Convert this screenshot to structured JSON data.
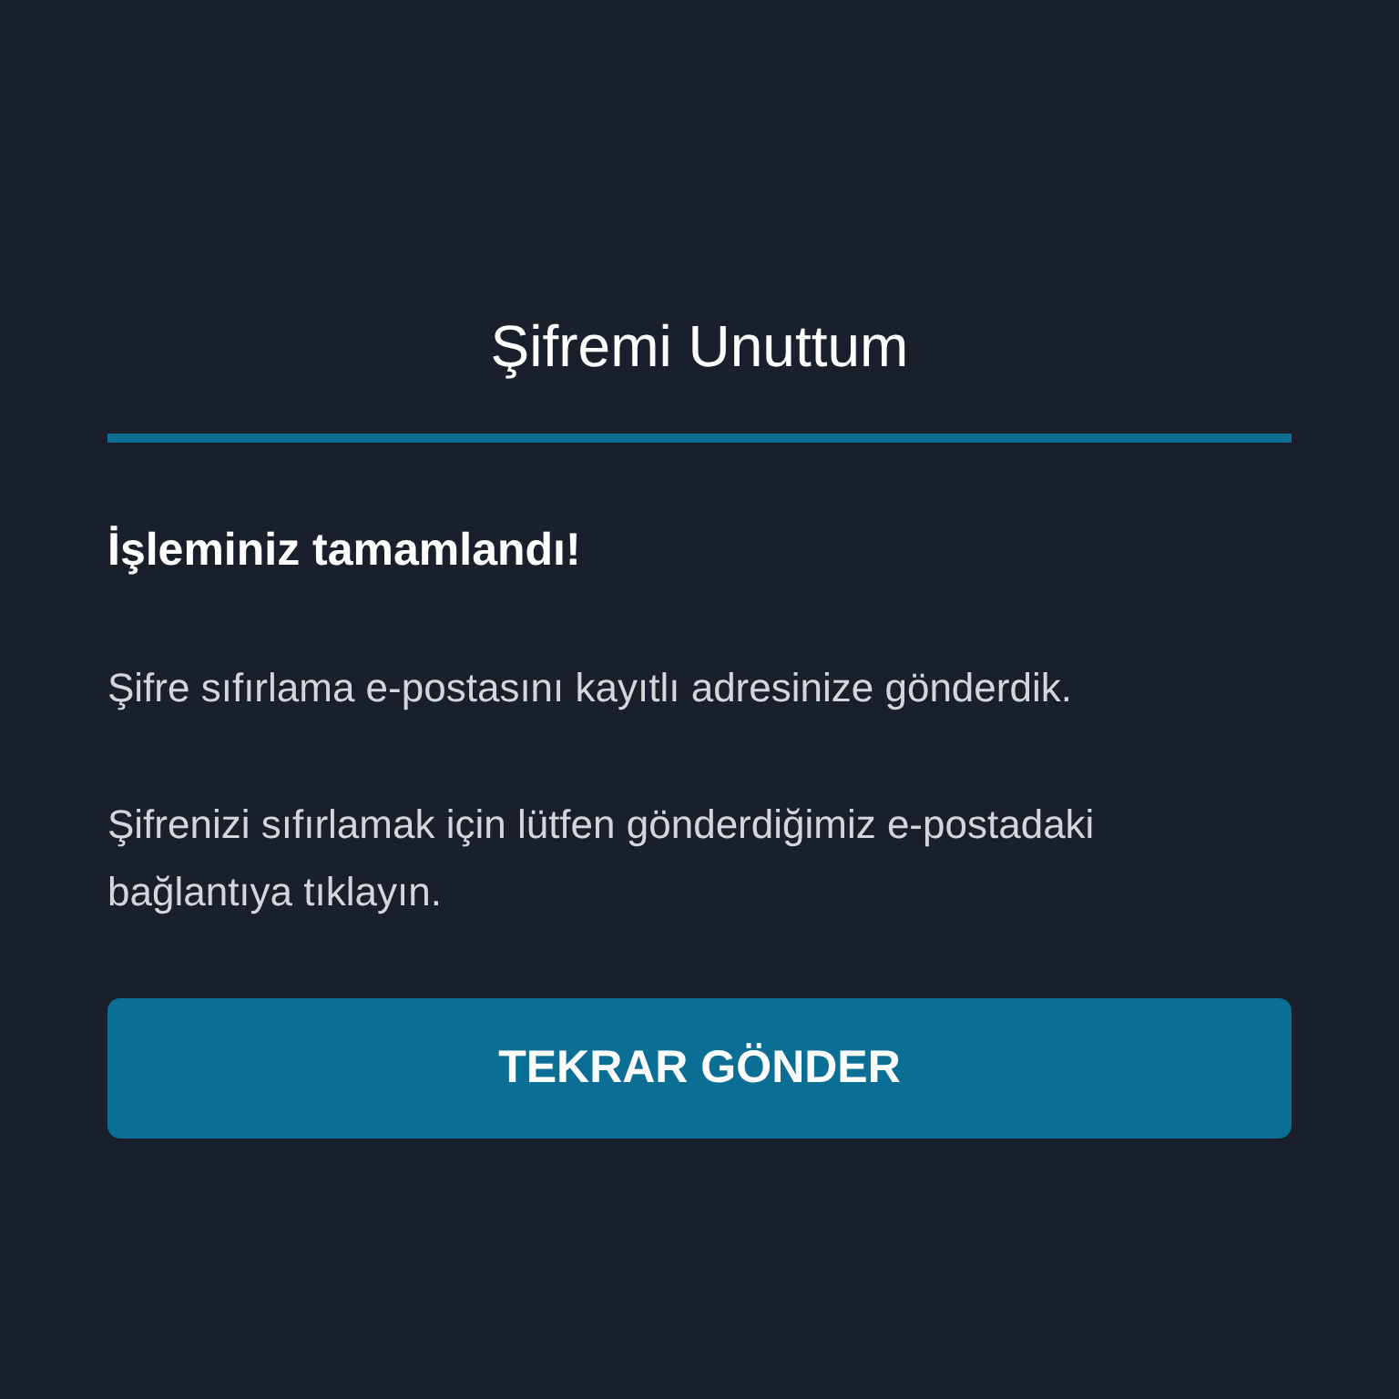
{
  "title": "Şifremi Unuttum",
  "heading": "İşleminiz tamamlandı!",
  "paragraphs": [
    "Şifre sıfırlama e-postasını kayıtlı adresinize gönderdik.",
    "Şifrenizi sıfırlamak için lütfen gönderdiğimiz e-postadaki bağlantıya tıklayın."
  ],
  "button": "TEKRAR GÖNDER"
}
